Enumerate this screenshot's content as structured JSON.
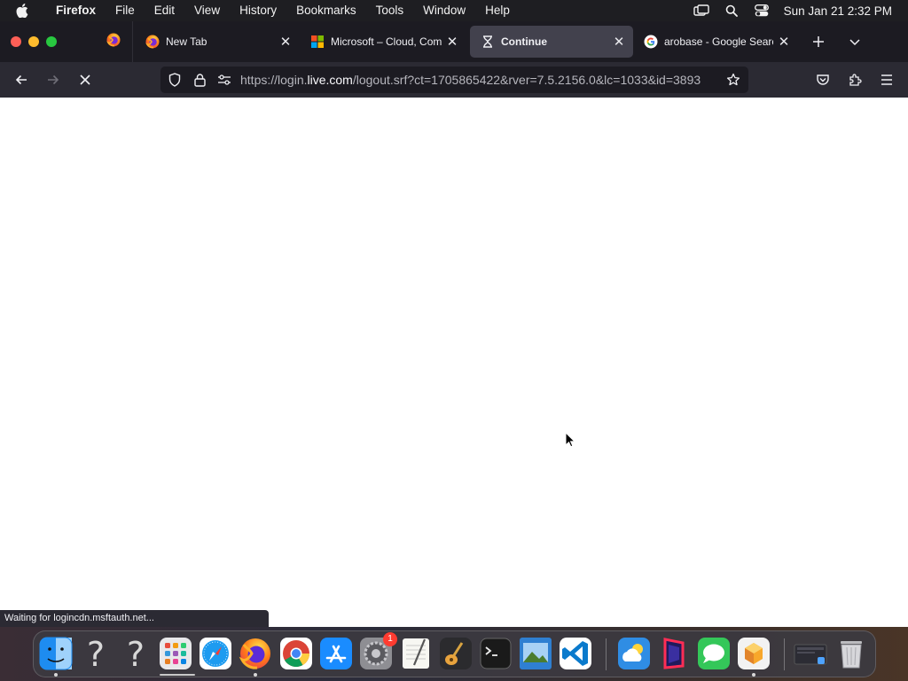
{
  "menubar": {
    "apple_icon": "apple-logo-icon",
    "app_name": "Firefox",
    "items": [
      "File",
      "Edit",
      "View",
      "History",
      "Bookmarks",
      "Tools",
      "Window",
      "Help"
    ],
    "status_icons": [
      "screen-mirroring-icon",
      "spotlight-search-icon",
      "control-center-icon"
    ],
    "clock": "Sun Jan 21  2:32 PM"
  },
  "tabs": [
    {
      "title": "New Tab",
      "favicon": "firefox-icon",
      "active": false
    },
    {
      "title": "Microsoft – Cloud, Comp",
      "favicon": "microsoft-logo-icon",
      "active": false
    },
    {
      "title": "Continue",
      "favicon": "hourglass-icon",
      "active": true
    },
    {
      "title": "arobase - Google Search",
      "favicon": "google-logo-icon",
      "active": false
    }
  ],
  "url": {
    "prefix": "https://login.",
    "domain": "live.com",
    "path": "/logout.srf?ct=1705865422&rver=7.5.2156.0&lc=1033&id=3893"
  },
  "status_bar": "Waiting for logincdn.msftauth.net...",
  "colors": {
    "menubar_bg": "#1e1e22",
    "tabstrip_bg": "#1c1b22",
    "toolbar_bg": "#2b2a33",
    "active_tab_bg": "#42414d",
    "content_bg": "#ffffff"
  },
  "dock": {
    "badge_settings": "1",
    "apps": [
      "finder",
      "unknown-app",
      "unknown-app",
      "launchpad",
      "safari",
      "firefox",
      "chrome",
      "app-store",
      "system-settings",
      "textedit",
      "garageband",
      "terminal",
      "preview",
      "vscode",
      "weather",
      "toolbox",
      "messages",
      "app-cleaner",
      "screen-recording",
      "trash"
    ]
  }
}
